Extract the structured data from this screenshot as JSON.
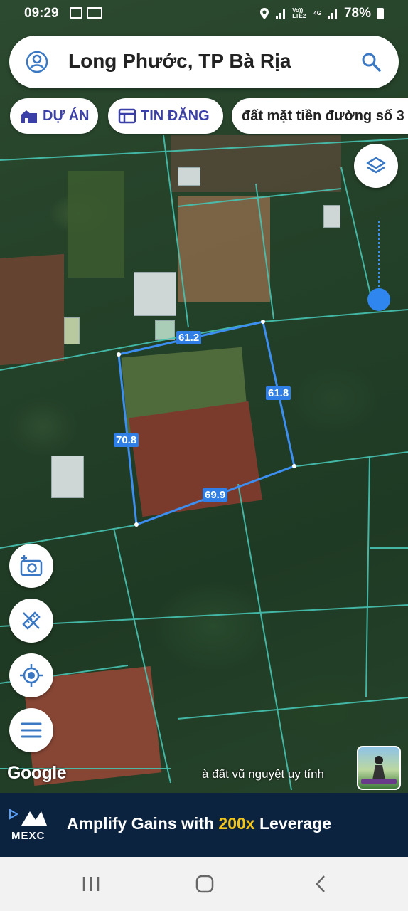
{
  "status_bar": {
    "time": "09:29",
    "carrier_label": "Vo)) LTE2",
    "network": "4G",
    "battery": "78%"
  },
  "search": {
    "title": "Long Phước, TP Bà Rịa",
    "left_icon": "account-circle-icon",
    "right_icon": "search-icon"
  },
  "chips": [
    {
      "label": "DỰ ÁN",
      "icon": "house-icon"
    },
    {
      "label": "TIN ĐĂNG",
      "icon": "listing-icon"
    },
    {
      "label": "đất mặt tiền đường số 3"
    }
  ],
  "map": {
    "measurements": [
      "61.2",
      "61.8",
      "70.8",
      "69.9"
    ],
    "attribution": "Google",
    "overlay_caption": "à đất vũ nguyệt uy tính"
  },
  "fabs": [
    "add-photo-icon",
    "ruler-pencil-icon",
    "my-location-icon",
    "menu-icon"
  ],
  "layers_button_icon": "layers-icon",
  "ad": {
    "brand": "MEXC",
    "tagline_pre": "Amplify Gains with ",
    "tagline_highlight": "200x",
    "tagline_post": " Leverage",
    "highlight_color": "#f0c419"
  },
  "nav": {
    "buttons": [
      "recents-icon",
      "home-icon",
      "back-icon"
    ]
  }
}
